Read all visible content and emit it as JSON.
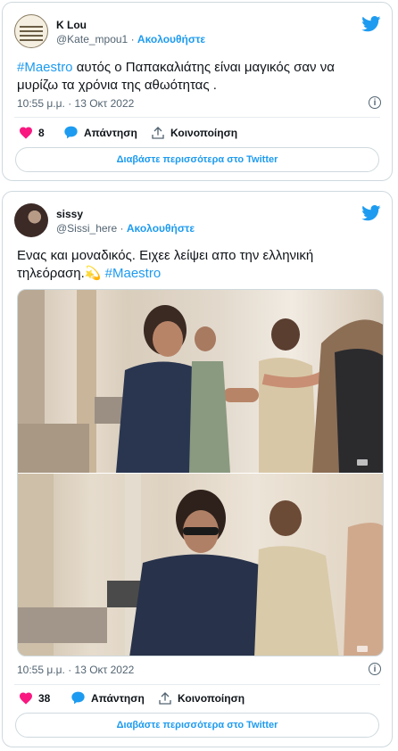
{
  "tweets": [
    {
      "display_name": "K Lou",
      "handle": "@Kate_mpou1",
      "separator": " · ",
      "follow_label": "Ακολουθήστε",
      "hashtag": "#Maestro",
      "text": " αυτός ο Παπακαλιάτης είναι μαγικός σαν να μυρίζω τα χρόνια της αθωότητας .",
      "timestamp": "10:55 μ.μ. · 13 Οκτ 2022",
      "likes": "8",
      "reply_label": "Απάντηση",
      "share_label": "Κοινοποίηση",
      "read_more_label": "Διαβάστε περισσότερα στο Twitter"
    },
    {
      "display_name": "sissy",
      "handle": "@Sissi_here",
      "separator": " · ",
      "follow_label": "Ακολουθήστε",
      "text": "Ενας και μοναδικός. Ειχεε λείψει  απο την ελληνική τηλεόραση.",
      "emoji": "💫",
      "hashtag": "#Maestro",
      "timestamp": "10:55 μ.μ. · 13 Οκτ 2022",
      "likes": "38",
      "reply_label": "Απάντηση",
      "share_label": "Κοινοποίηση",
      "read_more_label": "Διαβάστε περισσότερα στο Twitter"
    }
  ],
  "colors": {
    "accent": "#1d9bf0",
    "like": "#f91880",
    "muted": "#536471",
    "border": "#cfd9de"
  },
  "icons": [
    "twitter-bird-icon",
    "heart-icon",
    "reply-bubble-icon",
    "share-icon",
    "info-icon"
  ]
}
